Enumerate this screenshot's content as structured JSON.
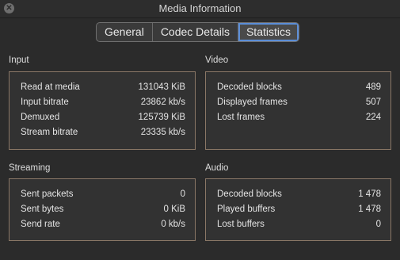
{
  "window": {
    "title": "Media Information",
    "close_glyph": "✕"
  },
  "tabs": [
    {
      "label": "General",
      "active": false
    },
    {
      "label": "Codec Details",
      "active": false
    },
    {
      "label": "Statistics",
      "active": true
    }
  ],
  "sections": {
    "input": {
      "label": "Input",
      "rows": [
        {
          "name": "Read at media",
          "value": "131043 KiB"
        },
        {
          "name": "Input bitrate",
          "value": "23862 kb/s"
        },
        {
          "name": "Demuxed",
          "value": "125739 KiB"
        },
        {
          "name": "Stream bitrate",
          "value": "23335 kb/s"
        }
      ]
    },
    "video": {
      "label": "Video",
      "rows": [
        {
          "name": "Decoded blocks",
          "value": "489"
        },
        {
          "name": "Displayed frames",
          "value": "507"
        },
        {
          "name": "Lost frames",
          "value": "224"
        }
      ]
    },
    "streaming": {
      "label": "Streaming",
      "rows": [
        {
          "name": "Sent packets",
          "value": "0"
        },
        {
          "name": "Sent bytes",
          "value": "0 KiB"
        },
        {
          "name": "Send rate",
          "value": "0 kb/s"
        }
      ]
    },
    "audio": {
      "label": "Audio",
      "rows": [
        {
          "name": "Decoded blocks",
          "value": "1 478"
        },
        {
          "name": "Played buffers",
          "value": "1 478"
        },
        {
          "name": "Lost buffers",
          "value": "0"
        }
      ]
    }
  },
  "colors": {
    "background": "#2b2b2b",
    "panel_border": "#8a7766",
    "active_tab_ring": "#5b8ed8"
  }
}
